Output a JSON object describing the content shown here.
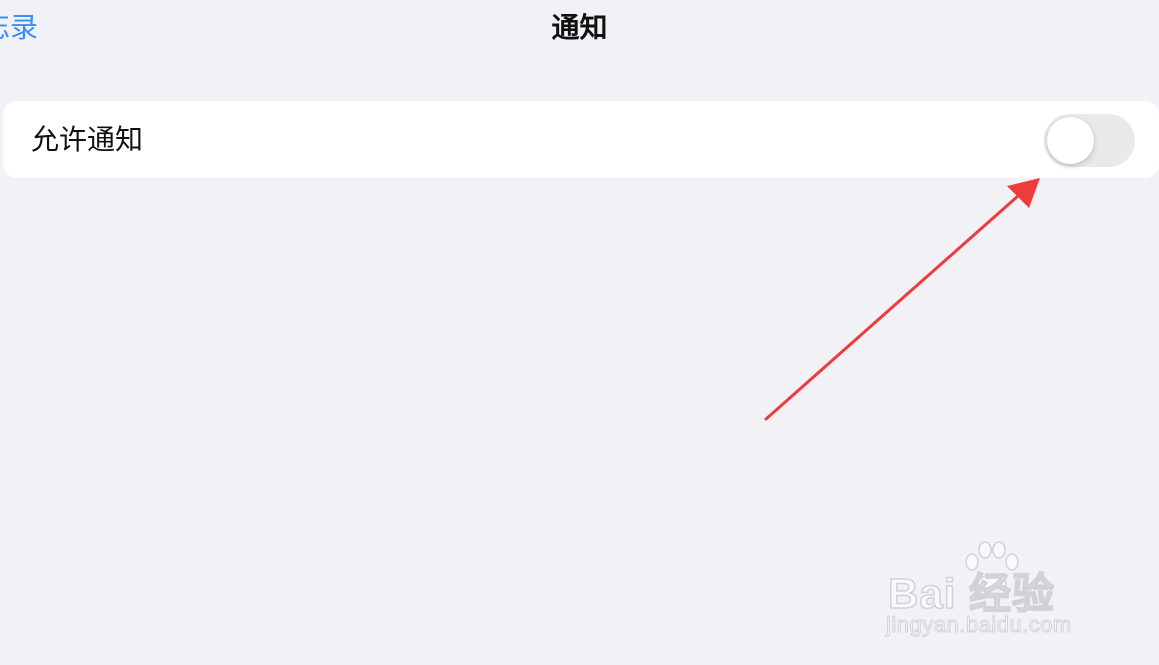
{
  "nav": {
    "back_label": "忘录",
    "title": "通知"
  },
  "settings": {
    "allow_notifications": {
      "label": "允许通知",
      "state": "off"
    }
  },
  "colors": {
    "background": "#f2f1f6",
    "accent": "#3c8ef7",
    "toggle_off": "#e9e9eb",
    "annotation_arrow": "#ee3b3b"
  },
  "watermark": {
    "brand": "Bai 经验",
    "url": "jingyan.baidu.com"
  }
}
